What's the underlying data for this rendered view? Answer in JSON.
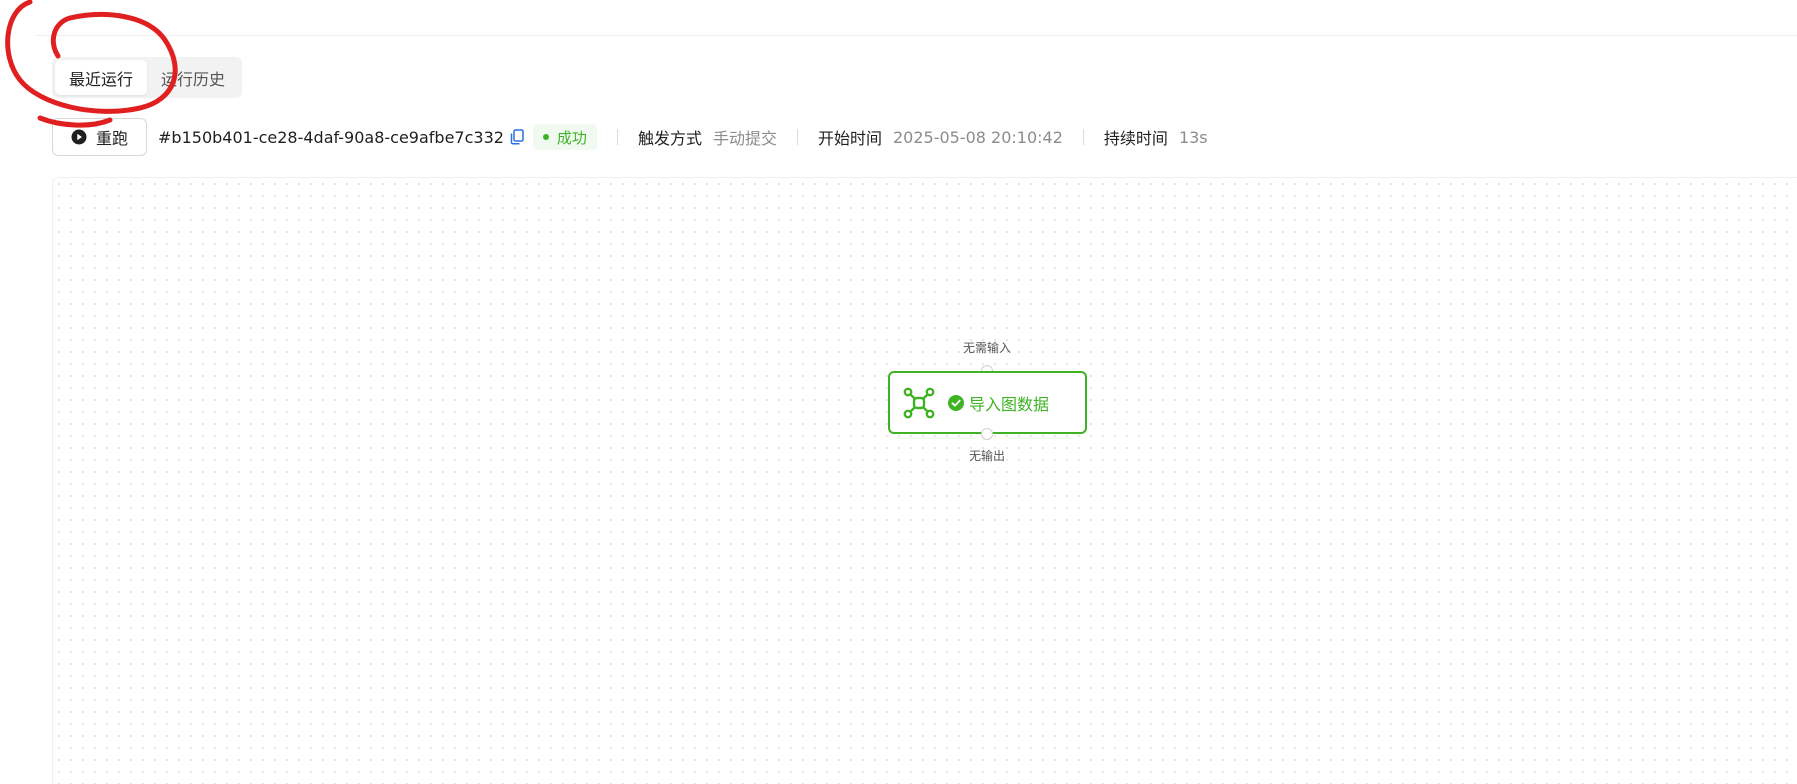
{
  "tabs": [
    {
      "label": "最近运行",
      "active": true
    },
    {
      "label": "运行历史",
      "active": false
    }
  ],
  "info_bar": {
    "rerun_label": "重跑",
    "run_id": "#b150b401-ce28-4daf-90a8-ce9afbe7c332",
    "status": "成功",
    "trigger_label": "触发方式",
    "trigger_value": "手动提交",
    "start_label": "开始时间",
    "start_value": "2025-05-08 20:10:42",
    "duration_label": "持续时间",
    "duration_value": "13s"
  },
  "node": {
    "label": "导入图数据",
    "input_hint": "无需输入",
    "output_hint": "无输出",
    "status": "success",
    "icon": "graph-icon"
  },
  "colors": {
    "success": "#3fb324",
    "annotation": "#e02020"
  }
}
